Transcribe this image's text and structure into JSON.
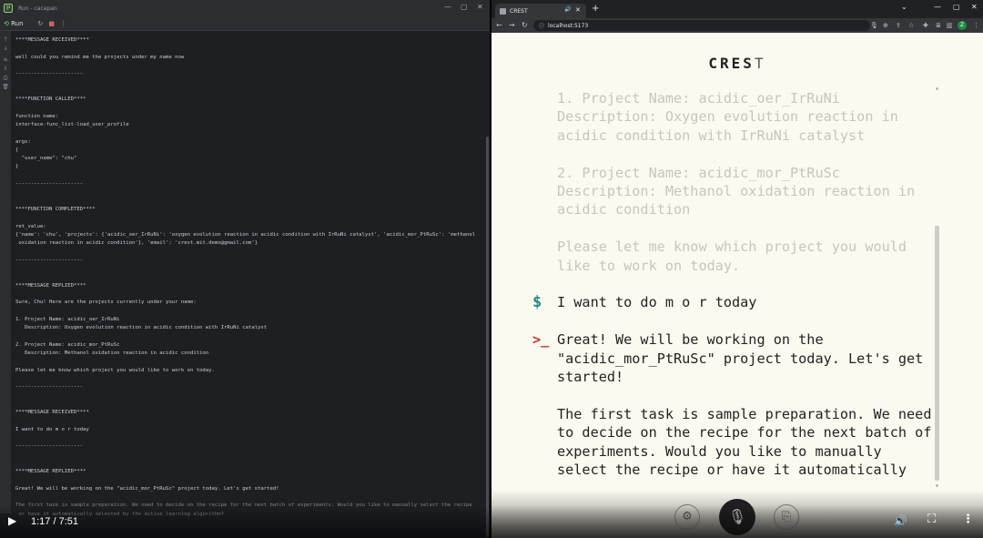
{
  "ide": {
    "window_title": "Run - cacapan",
    "toolbar": {
      "run_label": "Run"
    },
    "console_lines": [
      "****MESSAGE RECEIVED****",
      "",
      "well could you remind me the projects under my name now",
      "",
      "----------------------",
      "",
      "",
      "****FUNCTION CALLED****",
      "",
      "function name:",
      "interface-func_list-load_user_profile",
      "",
      "args:",
      "{",
      "  \"user_name\": \"chu\"",
      "}",
      "",
      "----------------------",
      "",
      "",
      "****FUNCTION COMPLETED****",
      "",
      "ret_value:",
      "{'name': 'chu', 'projects': {'acidic_oer_IrRuNi': 'oxygen evolution reaction in acidic condition with IrRuNi catalyst', 'acidic_mor_PtRuSc': 'methanol",
      " oxidation reaction in acidic condition'}, 'email': 'crest.mit.demo@gmail.com'}",
      "",
      "----------------------",
      "",
      "",
      "****MESSAGE REPLIED****",
      "",
      "Sure, Chu! Here are the projects currently under your name:",
      "",
      "1. Project Name: acidic_oer_IrRuNi",
      "   Description: Oxygen evolution reaction in acidic condition with IrRuNi catalyst",
      "",
      "2. Project Name: acidic_mor_PtRuSc",
      "   Description: Methanol oxidation reaction in acidic condition",
      "",
      "Please let me know which project you would like to work on today.",
      "",
      "----------------------",
      "",
      "",
      "****MESSAGE RECEIVED****",
      "",
      "I want to do m o r today",
      "",
      "----------------------",
      "",
      "",
      "****MESSAGE REPLIED****",
      "",
      "Great! We will be working on the \"acidic_mor_PtRuSc\" project today. Let's get started!",
      "",
      "The first task is sample preparation. We need to decide on the recipe for the next batch of experiments. Would you like to manually select the recipe",
      " or have it automatically selected by the active learning algorithm?"
    ]
  },
  "browser": {
    "tab_title": "CREST",
    "url": "localhost:5173",
    "profile_initial": "Z"
  },
  "app": {
    "brand_main": "CRES",
    "brand_last": "T",
    "messages": [
      {
        "role": "bot",
        "faded": true,
        "text": "1. Project Name: acidic_oer_IrRuNi\nDescription: Oxygen evolution reaction in\nacidic condition with IrRuNi catalyst\n\n2. Project Name: acidic_mor_PtRuSc\nDescription: Methanol oxidation reaction in\nacidic condition\n\nPlease let me know which project you would\nlike to work on today."
      },
      {
        "role": "user",
        "faded": false,
        "prompt": "$",
        "text": "I want to do m o r today"
      },
      {
        "role": "bot",
        "faded": false,
        "prompt": ">_",
        "text": "Great! We will be working on the\n\"acidic_mor_PtRuSc\" project today. Let's get\nstarted!\n\nThe first task is sample preparation. We need\nto decide on the recipe for the next batch of\nexperiments. Would you like to manually\nselect the recipe or have it automatically\nselected by the active learning algorithm?"
      }
    ]
  },
  "player": {
    "time": "1:17 / 7:51",
    "progress_fraction": 0.163
  },
  "icons": {
    "play": "play-icon",
    "volume": "volume-icon",
    "fullscreen": "fullscreen-icon",
    "more": "more-vert-icon",
    "mic": "microphone-icon",
    "settings": "gear-icon",
    "upload": "file-upload-icon"
  }
}
